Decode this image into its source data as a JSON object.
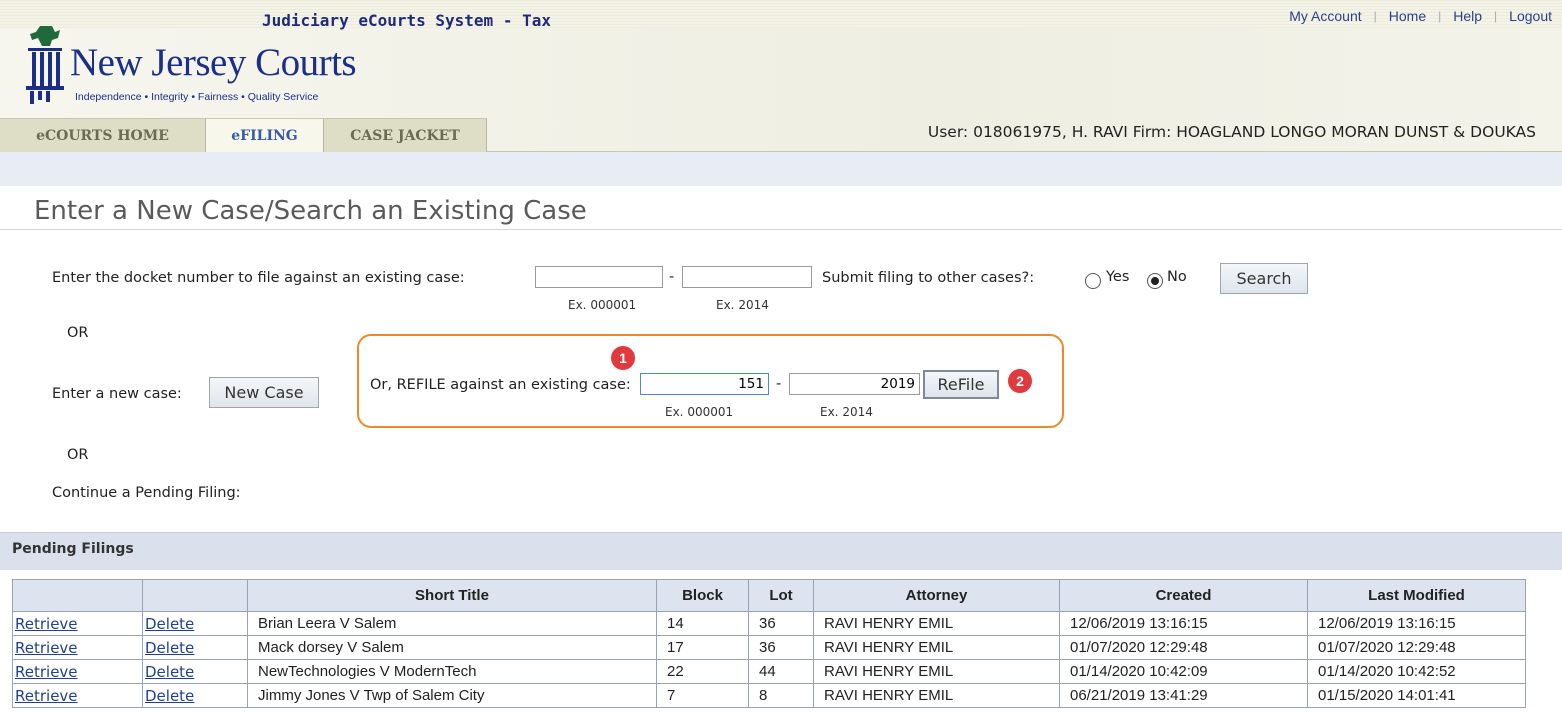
{
  "header": {
    "system_title": "Judiciary eCourts System - Tax",
    "links": [
      "My Account",
      "Home",
      "Help",
      "Logout"
    ],
    "logo_text": "New Jersey Courts",
    "logo_tagline": "Independence • Integrity • Fairness • Quality Service",
    "tabs": [
      {
        "label": "eCOURTS HOME",
        "active": false
      },
      {
        "label": "eFILING",
        "active": true
      },
      {
        "label": "CASE JACKET",
        "active": false
      }
    ],
    "user_info": "User: 018061975, H. RAVI  Firm: HOAGLAND LONGO MORAN DUNST & DOUKAS"
  },
  "page_title": "Enter a New Case/Search an Existing Case",
  "docket_search": {
    "label": "Enter the docket number to file against an existing case:",
    "number_value": "",
    "year_value": "",
    "separator": "-",
    "number_hint": "Ex. 000001",
    "year_hint": "Ex. 2014",
    "other_cases_label": "Submit filing to other cases?:",
    "yes_label": "Yes",
    "no_label": "No",
    "selected": "No",
    "search_button": "Search"
  },
  "or_label": "OR",
  "new_case": {
    "label": "Enter a new case:",
    "button": "New Case"
  },
  "refile": {
    "label": "Or, REFILE against an existing case:",
    "number_value": "151",
    "year_value": "2019",
    "separator": "-",
    "number_hint": "Ex. 000001",
    "year_hint": "Ex. 2014",
    "button": "ReFile",
    "marker_1": "1",
    "marker_2": "2"
  },
  "pending": {
    "continue_label": "Continue a Pending Filing:",
    "section_title": "Pending Filings",
    "columns": [
      "",
      "",
      "Short Title",
      "Block",
      "Lot",
      "Attorney",
      "Created",
      "Last Modified"
    ],
    "retrieve_label": "Retrieve",
    "delete_label": "Delete",
    "rows": [
      {
        "title": "Brian Leera V Salem",
        "block": "14",
        "lot": "36",
        "attorney": "RAVI HENRY EMIL",
        "created": "12/06/2019 13:16:15",
        "modified": "12/06/2019 13:16:15"
      },
      {
        "title": "Mack dorsey V Salem",
        "block": "17",
        "lot": "36",
        "attorney": "RAVI HENRY EMIL",
        "created": "01/07/2020 12:29:48",
        "modified": "01/07/2020 12:29:48"
      },
      {
        "title": "NewTechnologies V ModernTech",
        "block": "22",
        "lot": "44",
        "attorney": "RAVI HENRY EMIL",
        "created": "01/14/2020 10:42:09",
        "modified": "01/14/2020 10:42:52"
      },
      {
        "title": "Jimmy Jones V Twp of Salem City",
        "block": "7",
        "lot": "8",
        "attorney": "RAVI HENRY EMIL",
        "created": "06/21/2019 13:41:29",
        "modified": "01/15/2020 14:01:41"
      }
    ]
  },
  "colors": {
    "brand_blue": "#1b2f8a",
    "highlight_orange": "#ee8a25",
    "marker_red": "#e03a3e",
    "link_blue": "#1f3f9a"
  }
}
